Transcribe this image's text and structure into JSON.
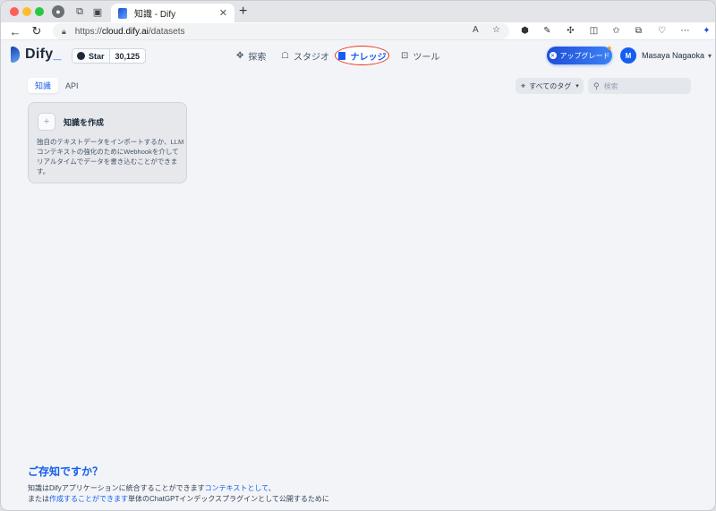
{
  "browser": {
    "tab_title": "知識 - Dify",
    "tab_close": "✕",
    "new_tab": "+",
    "url_scheme": "https://",
    "url_host": "cloud.dify.ai",
    "url_path": "/datasets",
    "read_aloud": "A",
    "profile_initial": "●"
  },
  "header": {
    "logo_text": "Dify",
    "logo_suffix": "_",
    "github_star_label": "Star",
    "github_star_count": "30,125",
    "nav": {
      "explore": "探索",
      "studio": "スタジオ",
      "knowledge": "ナレッジ",
      "tools": "ツール"
    },
    "upgrade_label": "アップグレード",
    "user_initial": "M",
    "user_name": "Masaya Nagaoka"
  },
  "tabs": {
    "knowledge": "知識",
    "api": "API"
  },
  "filters": {
    "all_tags": "すべてのタグ",
    "search_placeholder": "検索"
  },
  "create_card": {
    "title": "知識を作成",
    "description": "独自のテキストデータをインポートするか、LLMコンテキストの強化のためにWebhookを介してリアルタイムでデータを書き込むことができます。"
  },
  "tip": {
    "title": "ご存知ですか？",
    "line1_prefix": "知識はDifyアプリケーションに統合することができます",
    "line1_link": "コンテキストとして",
    "line1_suffix": "、",
    "line2_prefix": "または",
    "line2_link": "作成することができます",
    "line2_suffix": "単体のChatGPTインデックスプラグインとして公開するために"
  },
  "colors": {
    "accent": "#155eef",
    "highlight_ring": "#e5341d",
    "page_bg": "#f2f4f7"
  }
}
